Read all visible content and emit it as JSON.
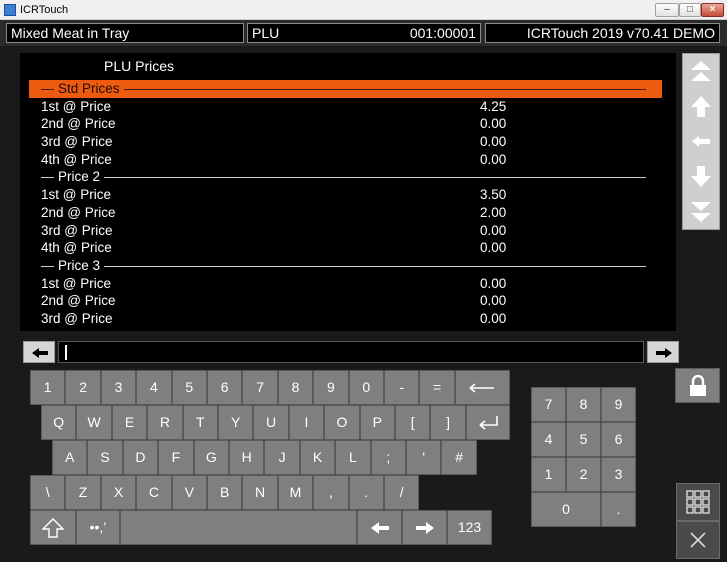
{
  "window": {
    "title": "ICRTouch"
  },
  "status": {
    "item_name": "Mixed Meat in Tray",
    "mode": "PLU",
    "record": "001:00001",
    "version": "ICRTouch 2019 v70.41 DEMO"
  },
  "panel": {
    "title": "PLU Prices",
    "rows": [
      {
        "type": "section",
        "label": "Std Prices",
        "selected": true
      },
      {
        "type": "item",
        "label": "1st @ Price",
        "value": "4.25"
      },
      {
        "type": "item",
        "label": "2nd @ Price",
        "value": "0.00"
      },
      {
        "type": "item",
        "label": "3rd @ Price",
        "value": "0.00"
      },
      {
        "type": "item",
        "label": "4th @ Price",
        "value": "0.00"
      },
      {
        "type": "section",
        "label": "Price 2",
        "selected": false
      },
      {
        "type": "item",
        "label": "1st @ Price",
        "value": "3.50"
      },
      {
        "type": "item",
        "label": "2nd @ Price",
        "value": "2.00"
      },
      {
        "type": "item",
        "label": "3rd @ Price",
        "value": "0.00"
      },
      {
        "type": "item",
        "label": "4th @ Price",
        "value": "0.00"
      },
      {
        "type": "section",
        "label": "Price 3",
        "selected": false
      },
      {
        "type": "item",
        "label": "1st @ Price",
        "value": "0.00"
      },
      {
        "type": "item",
        "label": "2nd @ Price",
        "value": "0.00"
      },
      {
        "type": "item",
        "label": "3rd @ Price",
        "value": "0.00"
      }
    ]
  },
  "input": {
    "value": ""
  },
  "keyboard": {
    "row1": [
      "1",
      "2",
      "3",
      "4",
      "5",
      "6",
      "7",
      "8",
      "9",
      "0",
      "-",
      "="
    ],
    "row2": [
      "Q",
      "W",
      "E",
      "R",
      "T",
      "Y",
      "U",
      "I",
      "O",
      "P",
      "[",
      "]"
    ],
    "row3": [
      "A",
      "S",
      "D",
      "F",
      "G",
      "H",
      "J",
      "K",
      "L",
      ";",
      "'",
      "#"
    ],
    "row4": [
      "\\",
      "Z",
      "X",
      "C",
      "V",
      "B",
      "N",
      "M",
      ",",
      ".",
      "/"
    ],
    "symbols_label": "••,’",
    "numeric_toggle_label": "123"
  },
  "numpad": {
    "keys": [
      "7",
      "8",
      "9",
      "4",
      "5",
      "6",
      "1",
      "2",
      "3",
      "0",
      "."
    ]
  },
  "colors": {
    "accent": "#ee5b10",
    "key_bg": "#7f7f7f",
    "panel_bg": "#000000"
  }
}
